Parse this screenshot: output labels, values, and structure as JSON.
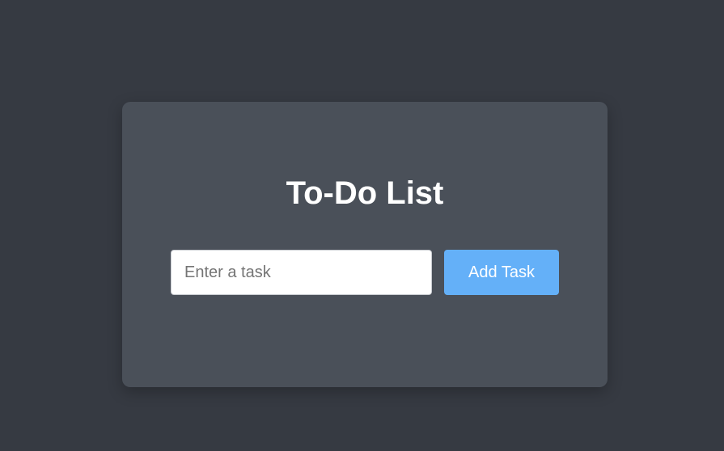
{
  "card": {
    "title": "To-Do List"
  },
  "task_form": {
    "input_value": "",
    "input_placeholder": "Enter a task",
    "add_button_label": "Add Task"
  },
  "colors": {
    "background": "#363a42",
    "card": "#4a5059",
    "accent": "#64b0f8",
    "title_text": "#ffffff"
  }
}
